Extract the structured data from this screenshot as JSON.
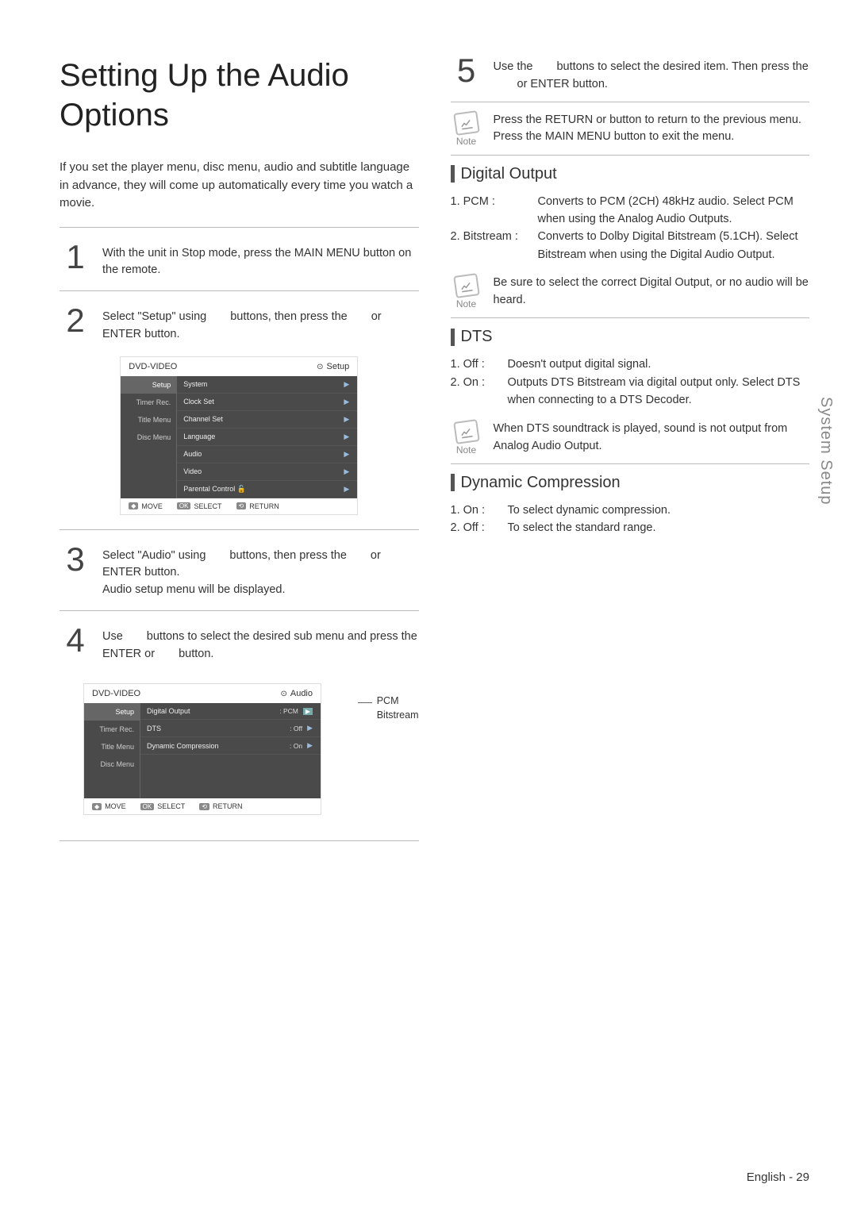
{
  "title": "Setting Up the Audio Options",
  "intro": "If you set the player menu, disc menu, audio and subtitle language in advance, they will come up automatically every time you watch a movie.",
  "steps": {
    "s1": "With the unit in Stop mode, press the MAIN MENU button on the remote.",
    "s2a": "Select \"Setup\" using",
    "s2b": "buttons, then press the",
    "s2c": "or ENTER button.",
    "s3a": "Select \"Audio\" using",
    "s3b": "buttons, then press the",
    "s3c": "or ENTER button.",
    "s3d": "Audio setup menu will be displayed.",
    "s4a": "Use",
    "s4b": "buttons to select the desired sub menu and press the ENTER or",
    "s4c": "button.",
    "s5a": "Use the",
    "s5b": "buttons to select the desired item. Then press the",
    "s5c": "or ENTER button."
  },
  "osd1": {
    "crumb": "DVD-VIDEO",
    "head": "Setup",
    "side": [
      "Setup",
      "Timer Rec.",
      "Title Menu",
      "Disc Menu"
    ],
    "rows": [
      "System",
      "Clock Set",
      "Channel Set",
      "Language",
      "Audio",
      "Video",
      "Parental Control"
    ],
    "foot": {
      "move": "MOVE",
      "select": "SELECT",
      "return": "RETURN"
    }
  },
  "osd2": {
    "crumb": "DVD-VIDEO",
    "head": "Audio",
    "side": [
      "Setup",
      "Timer Rec.",
      "Title Menu",
      "Disc Menu"
    ],
    "rows": [
      {
        "label": "Digital Output",
        "val": ": PCM",
        "hl": true
      },
      {
        "label": "DTS",
        "val": ": Off"
      },
      {
        "label": "Dynamic Compression",
        "val": ": On"
      }
    ],
    "callout": "PCM\nBitstream",
    "foot": {
      "move": "MOVE",
      "select": "SELECT",
      "return": "RETURN"
    }
  },
  "notes": {
    "n1": "Press the RETURN or        button to return to the previous menu. Press the MAIN MENU button to exit the menu.",
    "n2": "Be sure to select the correct Digital Output, or no audio will be heard.",
    "n3": "When DTS soundtrack is played, sound is not output from Analog Audio Output.",
    "noteLabel": "Note"
  },
  "sections": {
    "digital": {
      "title": "Digital Output",
      "items": [
        {
          "key": "1. PCM :",
          "val": "Converts to PCM (2CH) 48kHz audio. Select PCM when using the Analog Audio Outputs."
        },
        {
          "key": "2. Bitstream :",
          "val": "Converts to Dolby Digital Bitstream (5.1CH). Select Bitstream when using the Digital Audio Output."
        }
      ]
    },
    "dts": {
      "title": "DTS",
      "items": [
        {
          "key": "1. Off :",
          "val": "Doesn't output digital signal."
        },
        {
          "key": "2. On :",
          "val": "Outputs DTS Bitstream via digital output only. Select DTS when connecting to a DTS Decoder."
        }
      ]
    },
    "dynamic": {
      "title": "Dynamic Compression",
      "items": [
        {
          "key": "1. On :",
          "val": "To select dynamic compression."
        },
        {
          "key": "2. Off :",
          "val": "To select the standard range."
        }
      ]
    }
  },
  "sideTab": "System Setup",
  "footer": "English - 29"
}
